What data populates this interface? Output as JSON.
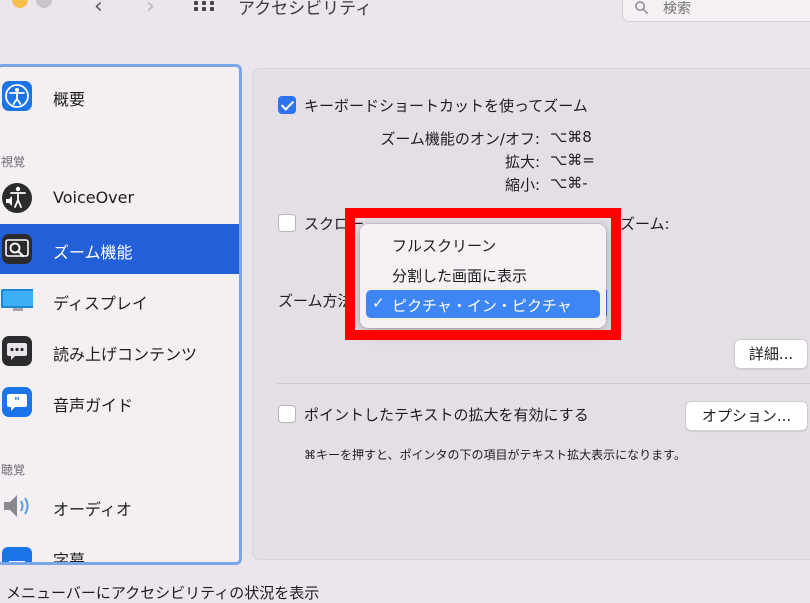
{
  "window": {
    "title": "アクセシビリティ",
    "search_placeholder": "検索"
  },
  "sidebar": {
    "sections": [
      {
        "label": "視覚"
      },
      {
        "label": "聴覚"
      }
    ],
    "items": [
      {
        "label": "概要",
        "icon": "accessibility-icon"
      },
      {
        "label": "VoiceOver",
        "icon": "voiceover-icon"
      },
      {
        "label": "ズーム機能",
        "icon": "zoom-icon",
        "selected": true
      },
      {
        "label": "ディスプレイ",
        "icon": "display-icon"
      },
      {
        "label": "読み上げコンテンツ",
        "icon": "spoken-content-icon"
      },
      {
        "label": "音声ガイド",
        "icon": "descriptions-icon"
      },
      {
        "label": "オーディオ",
        "icon": "audio-icon"
      },
      {
        "label": "字幕",
        "icon": "captions-icon"
      }
    ]
  },
  "main": {
    "keyboard_shortcut": {
      "label": "キーボードショートカットを使ってズーム",
      "checked": true,
      "rows": [
        {
          "label": "ズーム機能のオン/オフ:",
          "keys": "⌥⌘8"
        },
        {
          "label": "拡大:",
          "keys": "⌥⌘="
        },
        {
          "label": "縮小:",
          "keys": "⌥⌘-"
        }
      ]
    },
    "scroll_gesture": {
      "label_start": "スクロー",
      "label_end": "ズーム:",
      "checked": false
    },
    "zoom_style_label": "ズーム方法",
    "details_button": "詳細...",
    "hover_text": {
      "label": "ポイントしたテキストの拡大を有効にする",
      "checked": false,
      "options_button": "オプション...",
      "note": "⌘キーを押すと、ポインタの下の項目がテキスト拡大表示になります。"
    },
    "menubar_label": "メニューバーにアクセシビリティの状況を表示"
  },
  "zoom_style_menu": {
    "options": [
      "フルスクリーン",
      "分割した画面に表示",
      "ピクチャ・イン・ピクチャ"
    ],
    "selected": "ピクチャ・イン・ピクチャ",
    "check_mark": "✓"
  },
  "colors": {
    "accent": "#2360d8",
    "highlight": "#ff0000",
    "menu_selection": "#3f86f5"
  }
}
